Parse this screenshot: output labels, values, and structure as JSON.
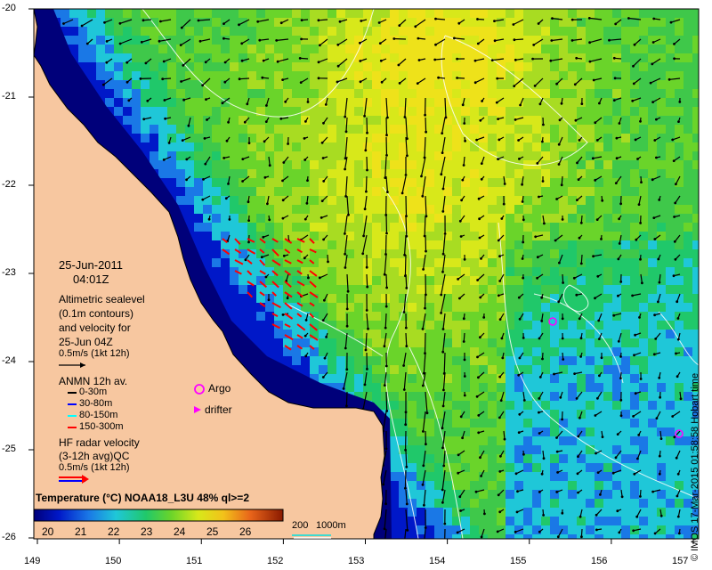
{
  "map": {
    "date": "25-Jun-2011",
    "time": "04:01Z",
    "x_ticks": [
      "149",
      "150",
      "151",
      "152",
      "153",
      "154",
      "155",
      "156",
      "157"
    ],
    "y_ticks": [
      "-20",
      "-21",
      "-22",
      "-23",
      "-24",
      "-25",
      "-26"
    ],
    "credit": "© IMOS 17-Mar-2015 01:58:58 Hobart time",
    "colors": {
      "land": "#f7c7a0",
      "deep_water": "#00007a",
      "contour": "#ffffff",
      "argo": "#ff00ff"
    }
  },
  "legend": {
    "altimetry_lines": [
      "Altimetric sealevel",
      "(0.1m contours)",
      "and velocity for",
      "25-Jun 04Z"
    ],
    "altimetry_scale": "0.5m/s (1kt 12h)",
    "anmn_title": "ANMN 12h av.",
    "anmn_depths": [
      {
        "label": "0-30m",
        "color": "#000000"
      },
      {
        "label": "30-80m",
        "color": "#0000ff"
      },
      {
        "label": "80-150m",
        "color": "#00ffff"
      },
      {
        "label": "150-300m",
        "color": "#ff0000"
      }
    ],
    "argo_label": "Argo",
    "drifter_label": "drifter",
    "hf_lines": [
      "HF radar velocity",
      "(3-12h avg)QC"
    ],
    "hf_scale": "0.5m/s (1kt 12h)"
  },
  "colorbar": {
    "title": "Temperature (°C) NOAA18_L3U 48% ql>=2",
    "ticks": [
      "20",
      "21",
      "22",
      "23",
      "24",
      "25",
      "26"
    ],
    "min": 19.5,
    "max": 27.2
  },
  "bathy_legend": {
    "label1": "200",
    "label2": "1000m"
  }
}
